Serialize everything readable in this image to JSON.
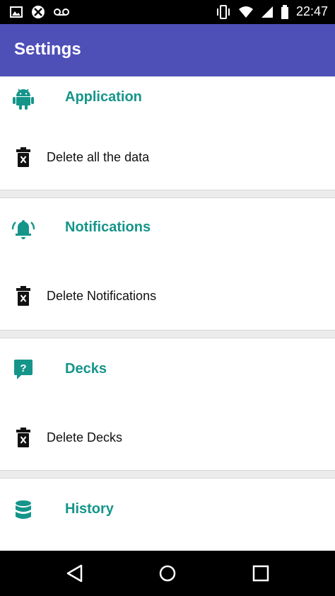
{
  "status_bar": {
    "time": "22:47",
    "icons": [
      "image-icon",
      "sync-off-icon",
      "voicemail-icon",
      "vibrate-icon",
      "wifi-icon",
      "signal-icon",
      "battery-icon"
    ]
  },
  "app_bar": {
    "title": "Settings",
    "color": "#4f4fb8"
  },
  "accent_color": "#15958a",
  "sections": [
    {
      "title": "Application",
      "icon": "android-icon",
      "item": {
        "label": "Delete all the data",
        "icon": "trash-icon"
      }
    },
    {
      "title": "Notifications",
      "icon": "bell-icon",
      "item": {
        "label": "Delete Notifications",
        "icon": "trash-icon"
      }
    },
    {
      "title": "Decks",
      "icon": "question-bubble-icon",
      "item": {
        "label": "Delete Decks",
        "icon": "trash-icon"
      }
    },
    {
      "title": "History",
      "icon": "database-icon"
    }
  ],
  "nav_bar": {
    "buttons": [
      "back-icon",
      "home-icon",
      "recents-icon"
    ]
  }
}
